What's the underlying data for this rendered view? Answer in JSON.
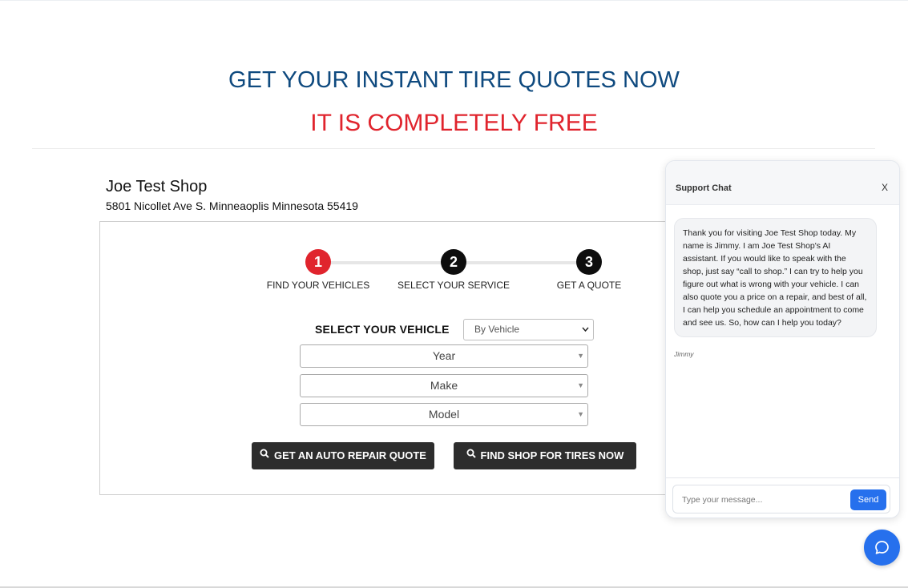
{
  "hero": {
    "title": "GET YOUR INSTANT TIRE QUOTES NOW",
    "subtitle": "IT IS COMPLETELY FREE"
  },
  "shop": {
    "name": "Joe Test Shop",
    "address": "5801 Nicollet Ave S. Minneaoplis Minnesota 55419"
  },
  "steps": [
    {
      "number": "1",
      "label": "FIND YOUR VEHICLES"
    },
    {
      "number": "2",
      "label": "SELECT YOUR SERVICE"
    },
    {
      "number": "3",
      "label": "GET A QUOTE"
    }
  ],
  "vehicle_form": {
    "label": "SELECT YOUR VEHICLE",
    "mode": "By Vehicle",
    "year": "Year",
    "make": "Make",
    "model": "Model"
  },
  "buttons": {
    "repair_quote": "GET AN AUTO REPAIR QUOTE",
    "find_tires": "FIND SHOP FOR TIRES NOW"
  },
  "chat": {
    "title": "Support Chat",
    "close": "X",
    "message": "Thank you for visiting Joe Test Shop today. My name is Jimmy. I am Joe Test Shop's AI assistant. If you would like to speak with the shop, just say “call to shop.” I can try to help you figure out what is wrong with your vehicle. I can also quote you a price on a repair, and best of all, I can help you schedule an appointment to come and see us. So, how can I help you today?",
    "sender": "Jimmy",
    "input_placeholder": "Type your message...",
    "send": "Send"
  },
  "colors": {
    "title_blue": "#0f4a7f",
    "accent_red": "#e0242d",
    "button_dark": "#2d2d2d",
    "chat_blue": "#2670ed"
  }
}
